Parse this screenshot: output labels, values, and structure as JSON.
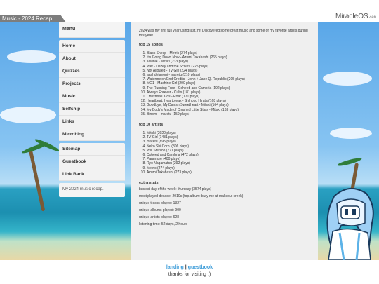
{
  "window": {
    "tab_title": "Music - 2024 Recap",
    "brand": "MiracleOS",
    "brand_suffix": "Zen"
  },
  "sidebar": {
    "header": "Menu",
    "items": [
      "Home",
      "About",
      "Quizzes",
      "Projects",
      "Music",
      "Selfship",
      "Links",
      "Microblog"
    ],
    "items2": [
      "Sitemap",
      "Guestbook",
      "Link Back"
    ],
    "note": "My 2024 music recap."
  },
  "main": {
    "intro": "2024 was my first full year using last.fm! Discovered some great music and some of my favorite artists during this year!",
    "songs_heading": "top 15 songs",
    "songs": [
      "Black Sheep - Metric (274 plays)",
      "It's Going Down Now - Azumi Takahashi (265 plays)",
      "Townie - Mitski (233 plays)",
      "Wet - Dazey and the Scouts (225 plays)",
      "Not Allowed - TV Girl (224 plays)",
      "aashdefanoni - maretu (210 plays)",
      "Watermelon End Credits - John + Jane Q. Republic (205 plays)",
      "MG1 - Machine Girl (200 plays)",
      "The Running Free - Coheed and Cambria (192 plays)",
      "Always Forever - Cults (181 plays)",
      "Christmas Kids - Roar (171 plays)",
      "Heartbeat, Heartbreak - Shihoko Hirata (168 plays)",
      "Goodbye, My Danish Sweetheart - Mitski (164 plays)",
      "My Body's Made of Crushed Little Stars - Mitski (163 plays)",
      "Binomi - maretu (159 plays)"
    ],
    "artists_heading": "top 10 artists",
    "artists": [
      "Mitski (2020 plays)",
      "TV Girl (1431 plays)",
      "maretu (895 plays)",
      "Neko Shi Corp. (806 plays)",
      "Will Stetson (771 plays)",
      "Coheed and Cambria (472 plays)",
      "Paramore (400 plays)",
      "Ryo Nagamatsu (292 plays)",
      "Metric (274 plays)",
      "Azumi Takahashi (273 plays)"
    ],
    "extra_heading": "extra stats",
    "stats": [
      "busiest day of the week: thursday (3574 plays)",
      "most played decade: 2010s (top album: bury me at makeout creek)",
      "unique tracks played: 1327",
      "unique albums played: 900",
      "unique artists played: 628",
      "listening time: 52 days, 2 hours"
    ]
  },
  "footer": {
    "link_landing": "landing",
    "separator": "|",
    "link_guestbook": "guestbook",
    "thanks": "thanks for visiting :)"
  },
  "colors": {
    "accent": "#3a9bd8",
    "titlebar_tab": "#7d7d7d",
    "panel": "#efefef"
  }
}
